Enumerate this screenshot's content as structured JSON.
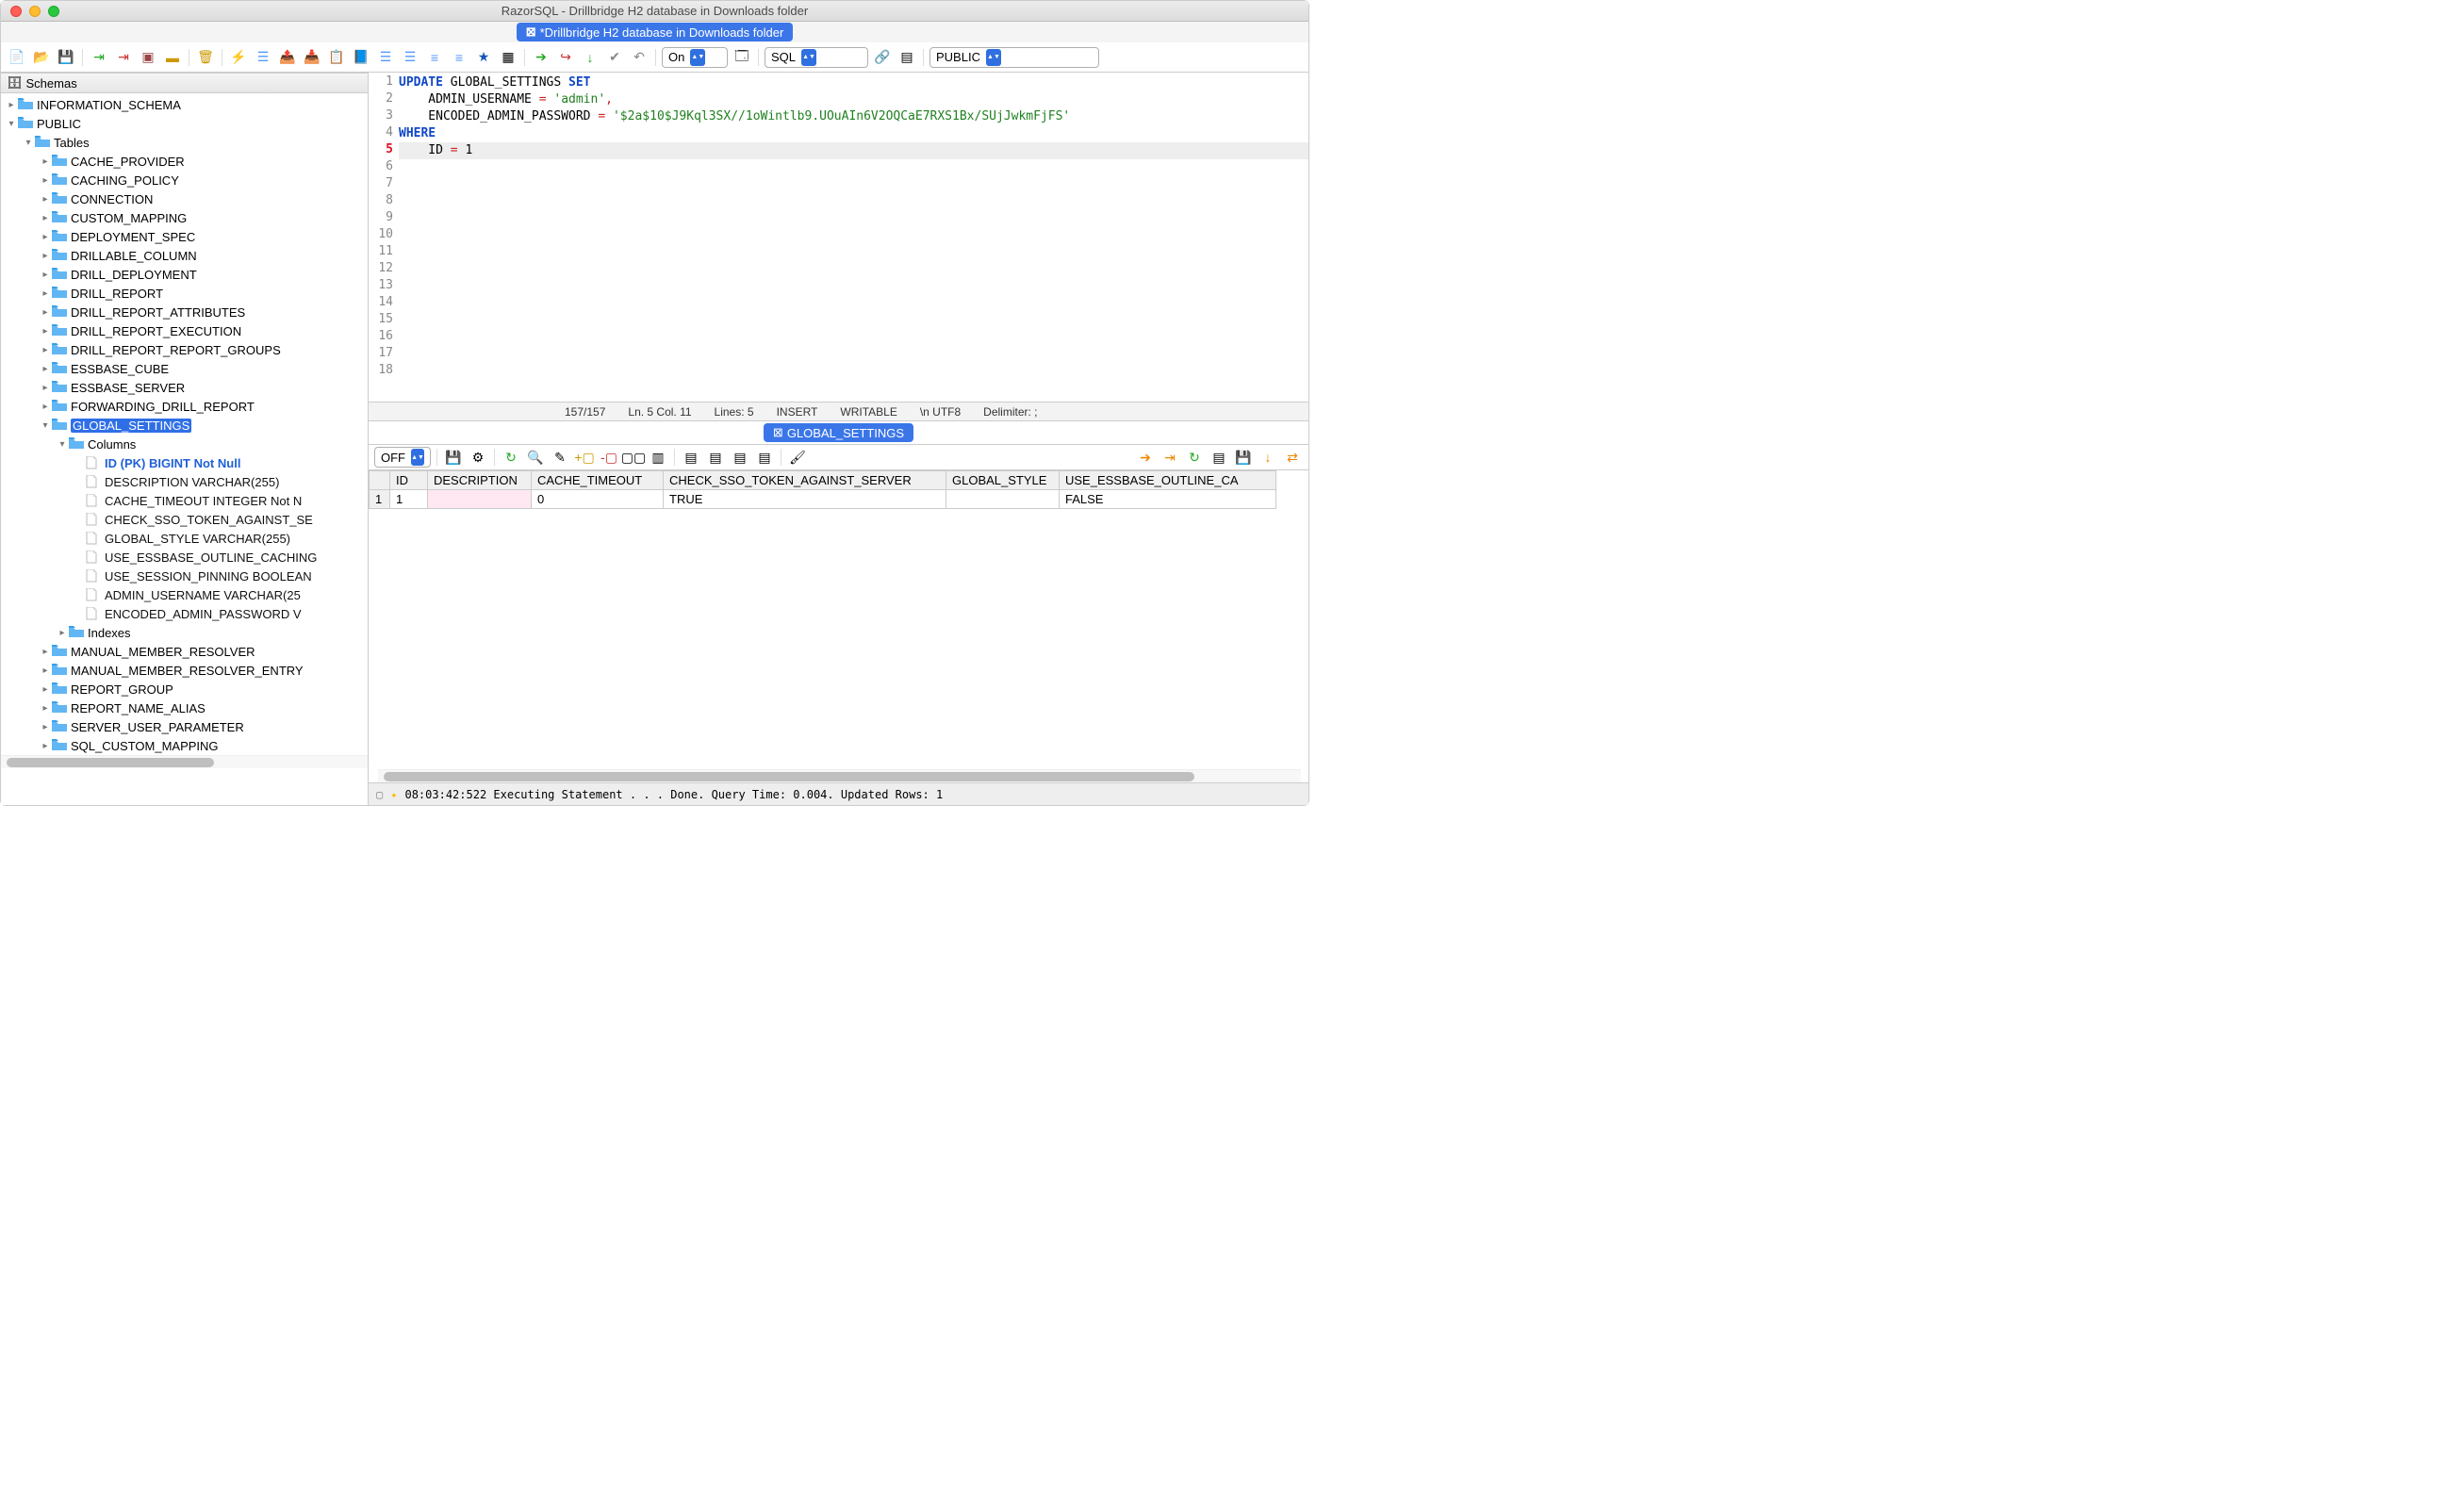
{
  "window": {
    "title": "RazorSQL - Drillbridge H2 database in Downloads folder",
    "doc_tab": "*Drillbridge H2 database in Downloads folder"
  },
  "toolbar_combo": {
    "on": "On",
    "lang": "SQL",
    "schema": "PUBLIC"
  },
  "sidebar": {
    "header": "Schemas",
    "schemas": [
      {
        "name": "INFORMATION_SCHEMA",
        "expanded": false
      },
      {
        "name": "PUBLIC",
        "expanded": true
      }
    ],
    "tables_label": "Tables",
    "tables": [
      "CACHE_PROVIDER",
      "CACHING_POLICY",
      "CONNECTION",
      "CUSTOM_MAPPING",
      "DEPLOYMENT_SPEC",
      "DRILLABLE_COLUMN",
      "DRILL_DEPLOYMENT",
      "DRILL_REPORT",
      "DRILL_REPORT_ATTRIBUTES",
      "DRILL_REPORT_EXECUTION",
      "DRILL_REPORT_REPORT_GROUPS",
      "ESSBASE_CUBE",
      "ESSBASE_SERVER",
      "FORWARDING_DRILL_REPORT",
      "GLOBAL_SETTINGS"
    ],
    "selected_table": "GLOBAL_SETTINGS",
    "columns_label": "Columns",
    "columns": [
      {
        "text": "ID (PK) BIGINT Not Null",
        "pk": true
      },
      {
        "text": "DESCRIPTION VARCHAR(255)"
      },
      {
        "text": "CACHE_TIMEOUT INTEGER Not N"
      },
      {
        "text": "CHECK_SSO_TOKEN_AGAINST_SE"
      },
      {
        "text": "GLOBAL_STYLE VARCHAR(255)"
      },
      {
        "text": "USE_ESSBASE_OUTLINE_CACHING"
      },
      {
        "text": "USE_SESSION_PINNING BOOLEAN"
      },
      {
        "text": "ADMIN_USERNAME VARCHAR(25"
      },
      {
        "text": "ENCODED_ADMIN_PASSWORD V"
      }
    ],
    "indexes_label": "Indexes",
    "tables_after": [
      "MANUAL_MEMBER_RESOLVER",
      "MANUAL_MEMBER_RESOLVER_ENTRY",
      "REPORT_GROUP",
      "REPORT_NAME_ALIAS",
      "SERVER_USER_PARAMETER",
      "SQL_CUSTOM_MAPPING"
    ]
  },
  "editor": {
    "lines": [
      {
        "n": 1,
        "tokens": [
          [
            "kw",
            "UPDATE"
          ],
          [
            "",
            " GLOBAL_SETTINGS "
          ],
          [
            "kw",
            "SET"
          ]
        ]
      },
      {
        "n": 2,
        "tokens": [
          [
            "",
            "    ADMIN_USERNAME "
          ],
          [
            "op",
            "="
          ],
          [
            "",
            " "
          ],
          [
            "str",
            "'admin'"
          ],
          [
            "op",
            ","
          ]
        ]
      },
      {
        "n": 3,
        "tokens": [
          [
            "",
            "    ENCODED_ADMIN_PASSWORD "
          ],
          [
            "op",
            "="
          ],
          [
            "",
            " "
          ],
          [
            "str",
            "'$2a$10$J9Kql3SX//1oWintlb9.UOuAIn6V2OQCaE7RXS1Bx/SUjJwkmFjFS'"
          ]
        ]
      },
      {
        "n": 4,
        "tokens": [
          [
            "kw",
            "WHERE"
          ]
        ]
      },
      {
        "n": 5,
        "hl": true,
        "err": true,
        "tokens": [
          [
            "",
            "    ID "
          ],
          [
            "op",
            "="
          ],
          [
            "",
            " 1"
          ]
        ]
      },
      {
        "n": 6
      },
      {
        "n": 7
      },
      {
        "n": 8
      },
      {
        "n": 9
      },
      {
        "n": 10
      },
      {
        "n": 11
      },
      {
        "n": 12
      },
      {
        "n": 13
      },
      {
        "n": 14
      },
      {
        "n": 15
      },
      {
        "n": 16
      },
      {
        "n": 17
      },
      {
        "n": 18
      }
    ],
    "status": {
      "chars": "157/157",
      "pos": "Ln. 5 Col. 11",
      "lines": "Lines: 5",
      "mode": "INSERT",
      "writable": "WRITABLE",
      "enc": "\\n  UTF8",
      "delim": "Delimiter: ;"
    }
  },
  "results": {
    "tab": "GLOBAL_SETTINGS",
    "off_label": "OFF",
    "headers": [
      "",
      "ID",
      "DESCRIPTION",
      "CACHE_TIMEOUT",
      "CHECK_SSO_TOKEN_AGAINST_SERVER",
      "GLOBAL_STYLE",
      "USE_ESSBASE_OUTLINE_CA"
    ],
    "row": {
      "n": "1",
      "ID": "1",
      "DESCRIPTION": "",
      "CACHE_TIMEOUT": "0",
      "CHECK": "TRUE",
      "GLOBAL_STYLE": "",
      "USE_ESSBASE": "FALSE"
    }
  },
  "bottom_status": "08:03:42:522 Executing Statement . . . Done. Query Time: 0.004. Updated Rows: 1"
}
